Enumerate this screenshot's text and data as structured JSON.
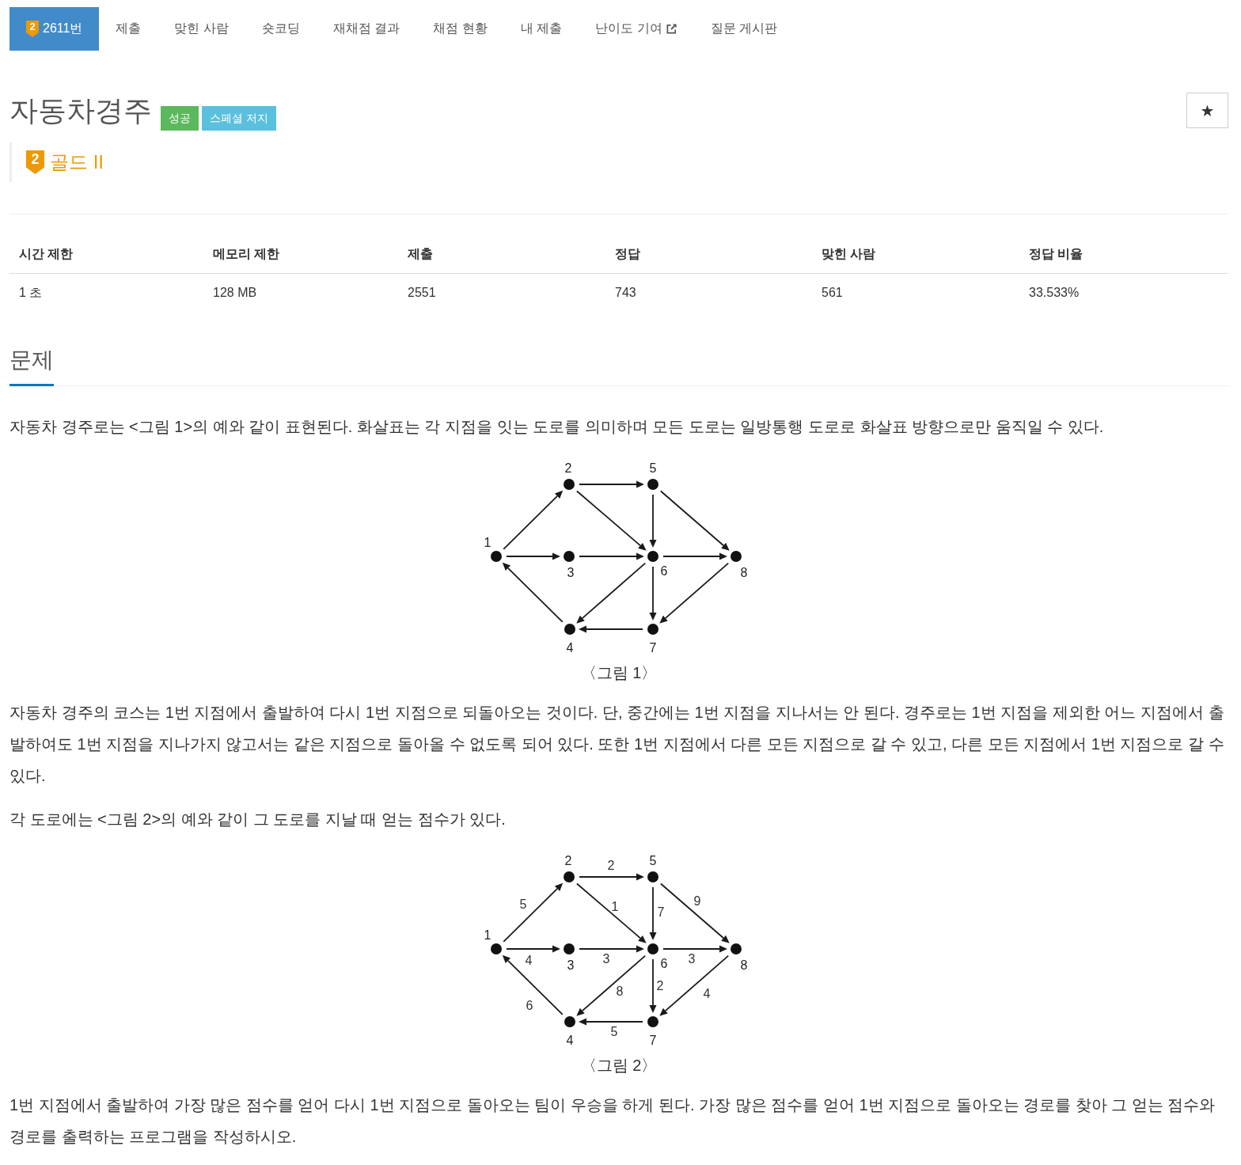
{
  "tabs": [
    {
      "label": "2611번",
      "badge": "2",
      "selected": true,
      "external": false
    },
    {
      "label": "제출",
      "selected": false,
      "external": false
    },
    {
      "label": "맞힌 사람",
      "selected": false,
      "external": false
    },
    {
      "label": "숏코딩",
      "selected": false,
      "external": false
    },
    {
      "label": "재채점 결과",
      "selected": false,
      "external": false
    },
    {
      "label": "채점 현황",
      "selected": false,
      "external": false
    },
    {
      "label": "내 제출",
      "selected": false,
      "external": false
    },
    {
      "label": "난이도 기여",
      "selected": false,
      "external": true
    },
    {
      "label": "질문 게시판",
      "selected": false,
      "external": false
    }
  ],
  "problem": {
    "title": "자동차경주",
    "labels": [
      {
        "text": "성공",
        "color": "#5cb85c"
      },
      {
        "text": "스페셜 저지",
        "color": "#5bc0de"
      }
    ],
    "star_button": "★",
    "tier": {
      "badge": "2",
      "name": "골드 II"
    }
  },
  "limits": {
    "columns": [
      "시간 제한",
      "메모리 제한",
      "제출",
      "정답",
      "맞힌 사람",
      "정답 비율"
    ],
    "rows": [
      [
        "1 초",
        "128 MB",
        "2551",
        "743",
        "561",
        "33.533%"
      ]
    ]
  },
  "section": {
    "heading": "문제",
    "body": [
      {
        "kind": "text",
        "text": "자동차 경주로는 <그림 1>의 예와 같이 표현된다. 화살표는 각 지점을 잇는 도로를 의미하며 모든 도로는 일방통행 도로로 화살표 방향으로만 움직일 수 있다."
      },
      {
        "kind": "figure",
        "nodes": [
          "1",
          "2",
          "3",
          "4",
          "5",
          "6",
          "7",
          "8"
        ],
        "caption": "〈그림 1〉"
      },
      {
        "kind": "text",
        "text": "자동차 경주의 코스는 1번 지점에서 출발하여 다시 1번 지점으로 되돌아오는 것이다. 단, 중간에는 1번 지점을 지나서는 안 된다. 경주로는 1번 지점을 제외한 어느 지점에서 출발하여도 1번 지점을 지나가지 않고서는 같은 지점으로 돌아올 수 없도록 되어 있다. 또한 1번 지점에서 다른 모든 지점으로 갈 수 있고, 다른 모든 지점에서 1번 지점으로 갈 수 있다."
      },
      {
        "kind": "text",
        "text": "각 도로에는 <그림 2>의 예와 같이 그 도로를 지날 때 얻는 점수가 있다."
      },
      {
        "kind": "figure",
        "nodes": [
          "1",
          "2",
          "3",
          "4",
          "5",
          "6",
          "7",
          "8"
        ],
        "edge_labels": [
          "5",
          "4",
          "2",
          "1",
          "3",
          "7",
          "9",
          "3",
          "8",
          "2",
          "4",
          "5",
          "6"
        ],
        "caption": "〈그림 2〉"
      },
      {
        "kind": "text",
        "text": "1번 지점에서 출발하여 가장 많은 점수를 얻어 다시 1번 지점으로 돌아오는 팀이 우승을 하게 된다. 가장 많은 점수를 얻어 1번 지점으로 돌아오는 경로를 찾아 그 얻는 점수와 경로를 출력하는 프로그램을 작성하시오."
      }
    ]
  }
}
